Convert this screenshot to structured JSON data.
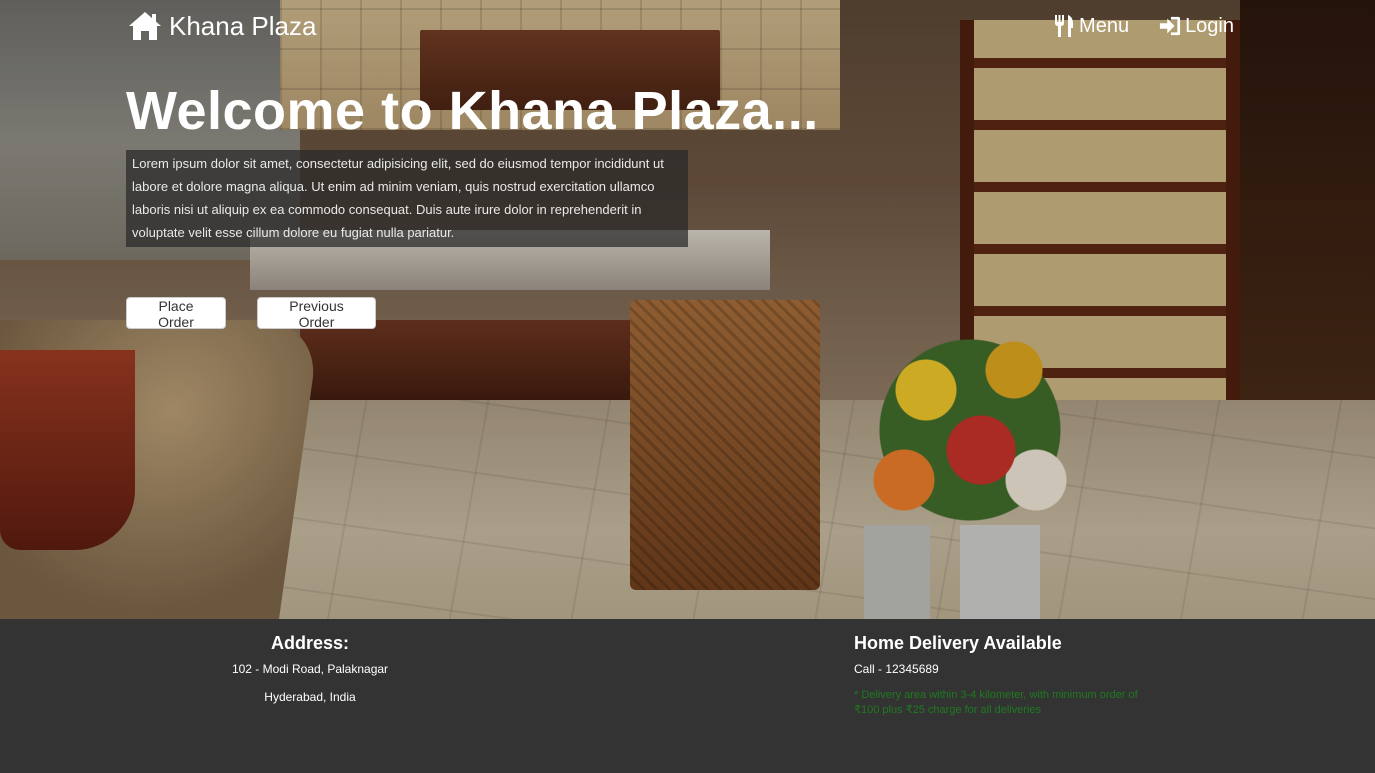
{
  "brand": {
    "name": "Khana Plaza",
    "icon": "home-icon"
  },
  "nav": [
    {
      "label": "Menu",
      "icon": "cutlery-icon"
    },
    {
      "label": "Login",
      "icon": "login-icon"
    }
  ],
  "hero": {
    "headline": "Welcome to Khana Plaza...",
    "lead": "Lorem ipsum dolor sit amet, consectetur adipisicing elit, sed do eiusmod tempor incididunt ut labore et dolore magna aliqua. Ut enim ad minim veniam, quis nostrud exercitation ullamco laboris nisi ut aliquip ex ea commodo consequat. Duis aute irure dolor in reprehenderit in voluptate velit esse cillum dolore eu fugiat nulla pariatur.",
    "buttons": {
      "place_order": "Place Order",
      "previous_order": "Previous Order"
    }
  },
  "footer": {
    "address": {
      "heading": "Address:",
      "line1": "102 - Modi Road, Palaknagar",
      "line2": "Hyderabad, India"
    },
    "delivery": {
      "heading": "Home Delivery Available",
      "call": "Call - 12345689",
      "note": "* Delivery area within 3-4 kilometer, with minimum order of ₹100 plus ₹25 charge for all deliveries"
    }
  },
  "colors": {
    "footer_bg": "#333333",
    "note_text": "#1f7a1f",
    "overlay": "rgba(40,40,40,0.72)"
  }
}
